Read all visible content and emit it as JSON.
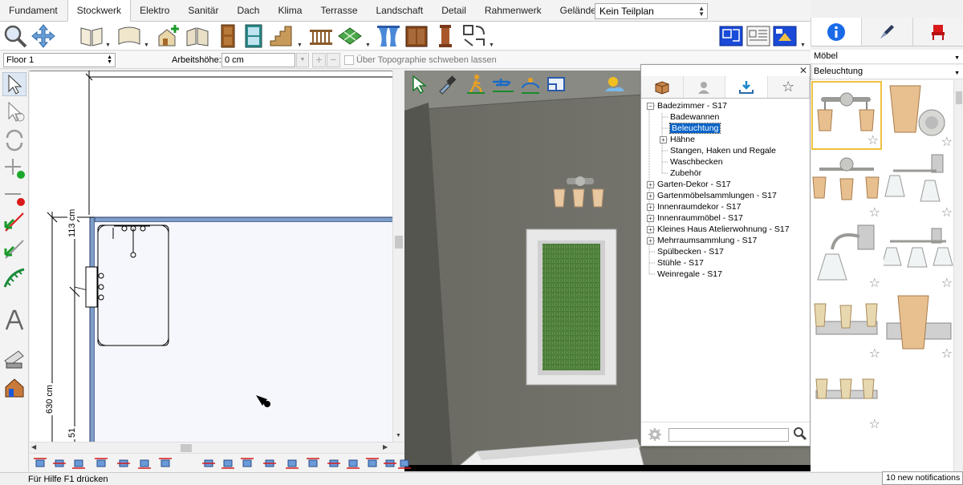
{
  "tabs": [
    "Fundament",
    "Stockwerk",
    "Elektro",
    "Sanitär",
    "Dach",
    "Klima",
    "Terrasse",
    "Landschaft",
    "Detail",
    "Rahmenwerk",
    "Gelände"
  ],
  "active_tab": "Stockwerk",
  "plan_select": {
    "value": "Kein Teilplan"
  },
  "subbar": {
    "floor": "Floor 1",
    "arbeitshoehe_label": "Arbeitshöhe:",
    "arbeitshoehe_value": "0 cm",
    "topo_label": "Über Topographie schweben lassen"
  },
  "right_panel": {
    "category": "Möbel",
    "subcategory": "Beleuchtung"
  },
  "plan": {
    "dim_113": "113 cm",
    "dim_630": "630 cm",
    "dim_51": "51"
  },
  "library": {
    "tree": [
      {
        "label": "Badezimmer - S17",
        "level": 0,
        "expander": "minus"
      },
      {
        "label": "Badewannen",
        "level": 1
      },
      {
        "label": "Beleuchtung",
        "level": 1,
        "selected": true
      },
      {
        "label": "Hähne",
        "level": 1,
        "expander": "plus"
      },
      {
        "label": "Stangen, Haken und Regale",
        "level": 1
      },
      {
        "label": "Waschbecken",
        "level": 1
      },
      {
        "label": "Zubehör",
        "level": 1
      },
      {
        "label": "Garten-Dekor - S17",
        "level": 0,
        "expander": "plus"
      },
      {
        "label": "Gartenmöbelsammlungen - S17",
        "level": 0,
        "expander": "plus"
      },
      {
        "label": "Innenraumdekor - S17",
        "level": 0,
        "expander": "plus"
      },
      {
        "label": "Innenraummöbel - S17",
        "level": 0,
        "expander": "plus"
      },
      {
        "label": "Kleines Haus Atelierwohnung - S17",
        "level": 0,
        "expander": "plus"
      },
      {
        "label": "Mehrraumsammlung - S17",
        "level": 0,
        "expander": "plus"
      },
      {
        "label": "Spülbecken - S17",
        "level": 0
      },
      {
        "label": "Stühle - S17",
        "level": 0
      },
      {
        "label": "Weinregale - S17",
        "level": 0
      }
    ]
  },
  "status": {
    "text": "Für Hilfe F1 drücken",
    "notifications": "10 new notifications"
  },
  "icons": {
    "select": "arrow-select-icon",
    "info": "info-icon",
    "pen": "pen-tool-icon",
    "chair": "chair-icon"
  },
  "colors": {
    "accent": "#0a64c8",
    "wall": "#7f9fc8",
    "thumb_selected": "#f0c040"
  }
}
